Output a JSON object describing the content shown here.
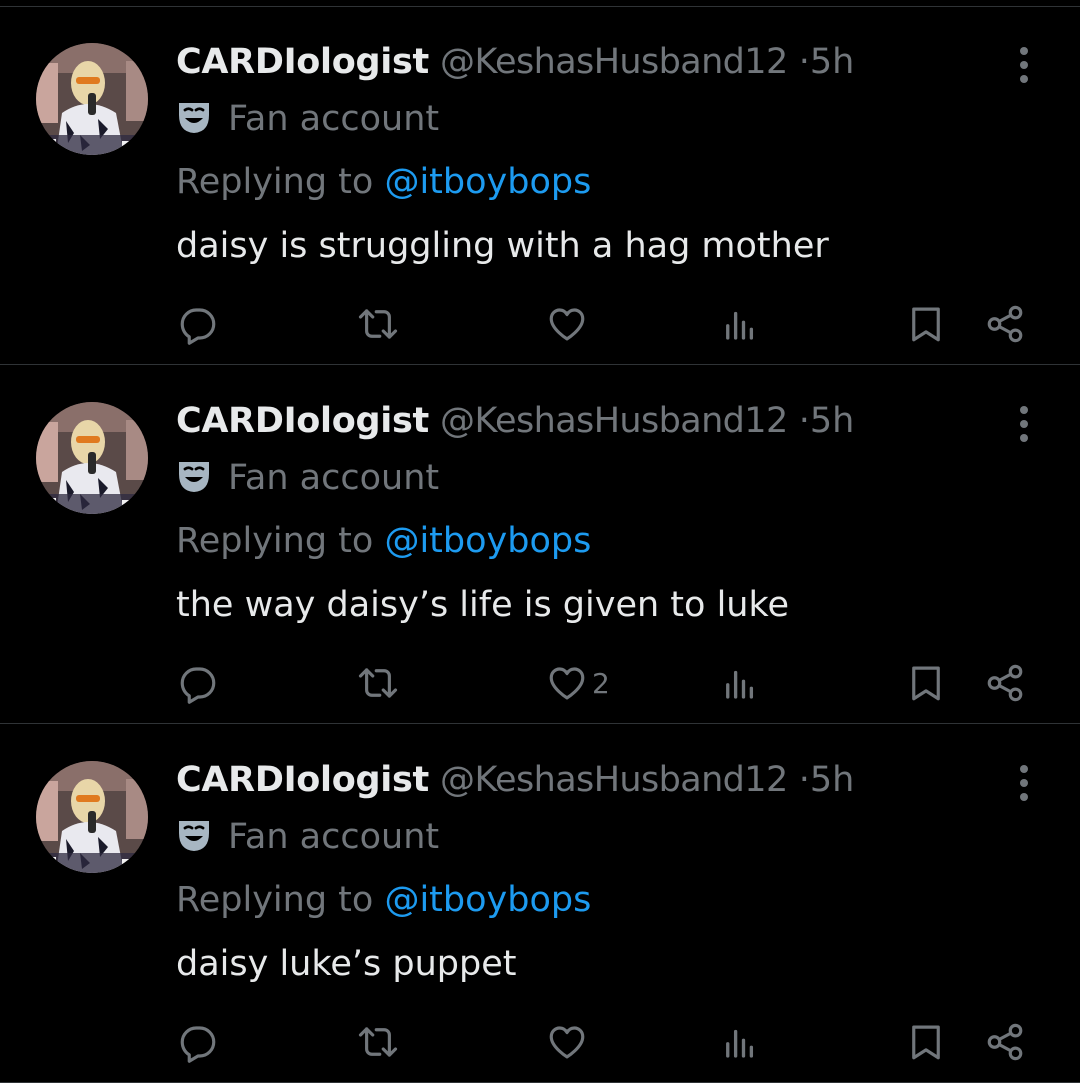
{
  "colors": {
    "background": "#000000",
    "text_primary": "#e7e9ea",
    "text_secondary": "#71767b",
    "mention": "#1d9bf0",
    "divider": "#2f3336"
  },
  "tweets": [
    {
      "display_name": "CARDIologist",
      "handle": "@KeshasHusband12",
      "separator": "·",
      "time": "5h",
      "label_icon": "theater-mask-icon",
      "label": "Fan account",
      "replying_prefix": "Replying to ",
      "replying_to": "@itboybops",
      "text": "daisy is struggling with a hag mother",
      "like_count": ""
    },
    {
      "display_name": "CARDIologist",
      "handle": "@KeshasHusband12",
      "separator": "·",
      "time": "5h",
      "label_icon": "theater-mask-icon",
      "label": "Fan account",
      "replying_prefix": "Replying to ",
      "replying_to": "@itboybops",
      "text": "the way daisy’s life is given to luke",
      "like_count": "2"
    },
    {
      "display_name": "CARDIologist",
      "handle": "@KeshasHusband12",
      "separator": "·",
      "time": "5h",
      "label_icon": "theater-mask-icon",
      "label": "Fan account",
      "replying_prefix": "Replying to ",
      "replying_to": "@itboybops",
      "text": "daisy luke’s puppet",
      "like_count": ""
    }
  ]
}
